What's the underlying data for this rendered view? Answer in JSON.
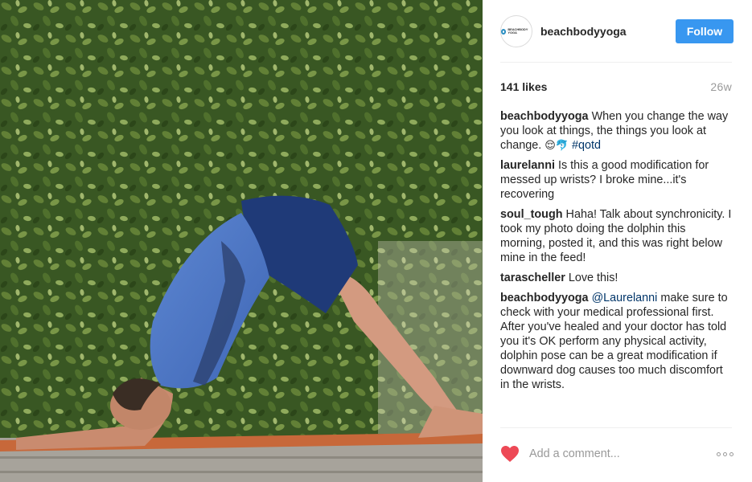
{
  "post": {
    "username": "beachbodyyoga",
    "avatar_text": "BEACHBODY YOGA",
    "follow_label": "Follow",
    "likes": "141 likes",
    "age": "26w",
    "comment_placeholder": "Add a comment...",
    "comments": [
      {
        "author": "beachbodyyoga",
        "text": "When you change the way you look at things, the things you look at change.",
        "emoji": "😌🐬",
        "tag": "#qotd"
      },
      {
        "author": "laurelanni",
        "text": "Is this a good modification for messed up wrists? I broke mine...it's recovering"
      },
      {
        "author": "soul_tough",
        "text": "Haha! Talk about synchronicity. I took my photo doing the dolphin this morning, posted it, and this was right below mine in the feed!"
      },
      {
        "author": "tarascheller",
        "text": "Love this!"
      },
      {
        "author": "beachbodyyoga",
        "mention": "@Laurelanni",
        "text": "make sure to check with your medical professional first. After you've healed and your doctor has told you it's OK perform any physical activity, dolphin pose can be a great modification if downward dog causes too much discomfort in the wrists."
      }
    ]
  },
  "colors": {
    "follow_button": "#3897f0",
    "heart": "#ed4956",
    "hashtag": "#003569"
  },
  "icons": {
    "heart": "heart-icon",
    "more": "more-options-icon"
  }
}
